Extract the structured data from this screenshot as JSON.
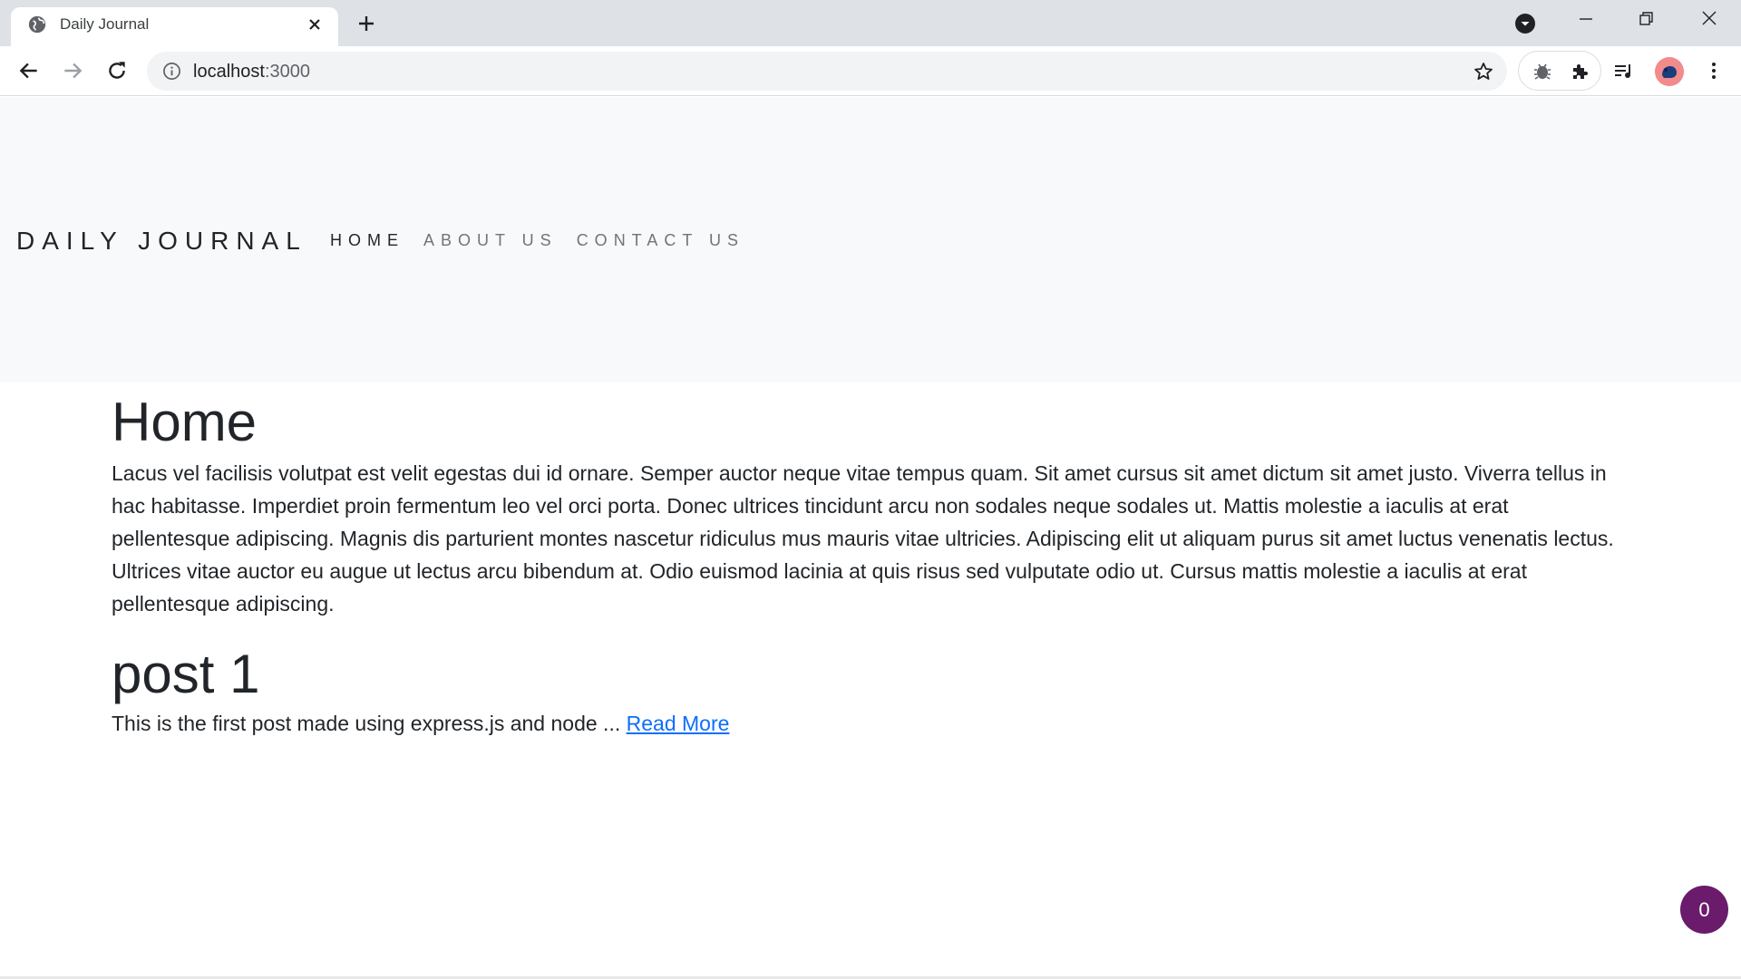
{
  "browser": {
    "tab_title": "Daily Journal",
    "url_host": "localhost",
    "url_port": ":3000",
    "icons": [
      "globe-icon",
      "close-icon",
      "plus-icon",
      "tab-search-icon",
      "minimize-icon",
      "restore-icon",
      "window-close-icon",
      "back-icon",
      "forward-icon",
      "reload-icon",
      "info-icon",
      "star-icon",
      "bug-icon",
      "puzzle-icon",
      "media-icon",
      "avatar",
      "more-icon"
    ]
  },
  "navbar": {
    "brand": "DAILY JOURNAL",
    "links": [
      {
        "label": "HOME",
        "active": true
      },
      {
        "label": "ABOUT US",
        "active": false
      },
      {
        "label": "CONTACT US",
        "active": false
      }
    ]
  },
  "main": {
    "title": "Home",
    "intro": "Lacus vel facilisis volutpat est velit egestas dui id ornare. Semper auctor neque vitae tempus quam. Sit amet cursus sit amet dictum sit amet justo. Viverra tellus in hac habitasse. Imperdiet proin fermentum leo vel orci porta. Donec ultrices tincidunt arcu non sodales neque sodales ut. Mattis molestie a iaculis at erat pellentesque adipiscing. Magnis dis parturient montes nascetur ridiculus mus mauris vitae ultricies. Adipiscing elit ut aliquam purus sit amet luctus venenatis lectus. Ultrices vitae auctor eu augue ut lectus arcu bibendum at. Odio euismod lacinia at quis risus sed vulputate odio ut. Cursus mattis molestie a iaculis at erat pellentesque adipiscing.",
    "posts": [
      {
        "title": "post 1",
        "excerpt": "This is the first post made using express.js and node ...",
        "link_label": "Read More"
      }
    ]
  },
  "badge": {
    "count": "0",
    "color": "#6a1b6b"
  },
  "colors": {
    "link": "#0d6efd",
    "navbar_bg": "#f8f9fa",
    "text": "#212529"
  }
}
